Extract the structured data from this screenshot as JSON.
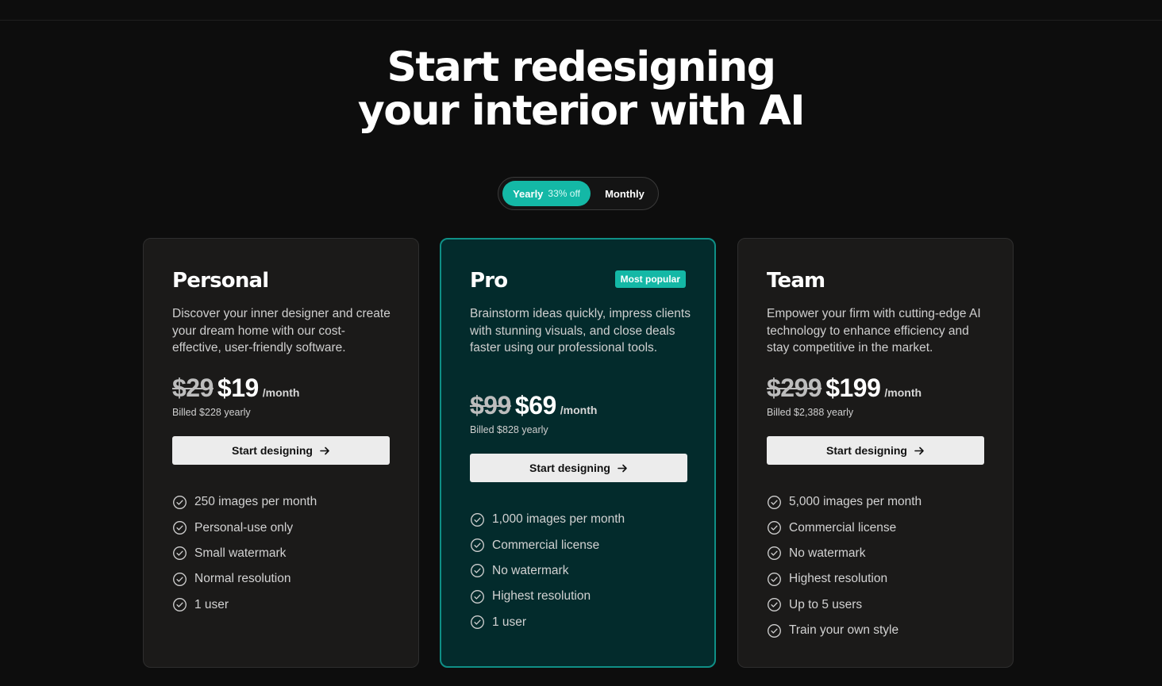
{
  "hero": {
    "title_line1": "Start redesigning",
    "title_line2": "your interior with AI"
  },
  "billing_toggle": {
    "yearly_label": "Yearly",
    "yearly_discount": "33% off",
    "monthly_label": "Monthly",
    "selected": "Yearly"
  },
  "colors": {
    "accent": "#14b8a6",
    "pro_card_bg": "#032b2c",
    "pro_card_border": "#0f8f86",
    "card_bg": "#1b1a19",
    "page_bg": "#0d0d0d"
  },
  "plans": [
    {
      "name": "Personal",
      "description": "Discover your inner designer and create your dream home with our cost-effective, user-friendly software.",
      "old_price": "$29",
      "new_price": "$19",
      "unit": "/month",
      "billed": "Billed $228 yearly",
      "cta": "Start designing",
      "features": [
        "250 images per month",
        "Personal-use only",
        "Small watermark",
        "Normal resolution",
        "1 user"
      ]
    },
    {
      "name": "Pro",
      "badge": "Most popular",
      "description": "Brainstorm ideas quickly, impress clients with stunning visuals, and close deals faster using our professional tools.",
      "old_price": "$99",
      "new_price": "$69",
      "unit": "/month",
      "billed": "Billed $828 yearly",
      "cta": "Start designing",
      "features": [
        "1,000 images per month",
        "Commercial license",
        "No watermark",
        "Highest resolution",
        "1 user"
      ]
    },
    {
      "name": "Team",
      "description": "Empower your firm with cutting-edge AI technology to enhance efficiency and stay competitive in the market.",
      "old_price": "$299",
      "new_price": "$199",
      "unit": "/month",
      "billed": "Billed $2,388 yearly",
      "cta": "Start designing",
      "features": [
        "5,000 images per month",
        "Commercial license",
        "No watermark",
        "Highest resolution",
        "Up to 5 users",
        "Train your own style"
      ]
    }
  ],
  "icons": {
    "cta_arrow": "arrow-right-icon",
    "feature_check": "check-circle-icon"
  }
}
